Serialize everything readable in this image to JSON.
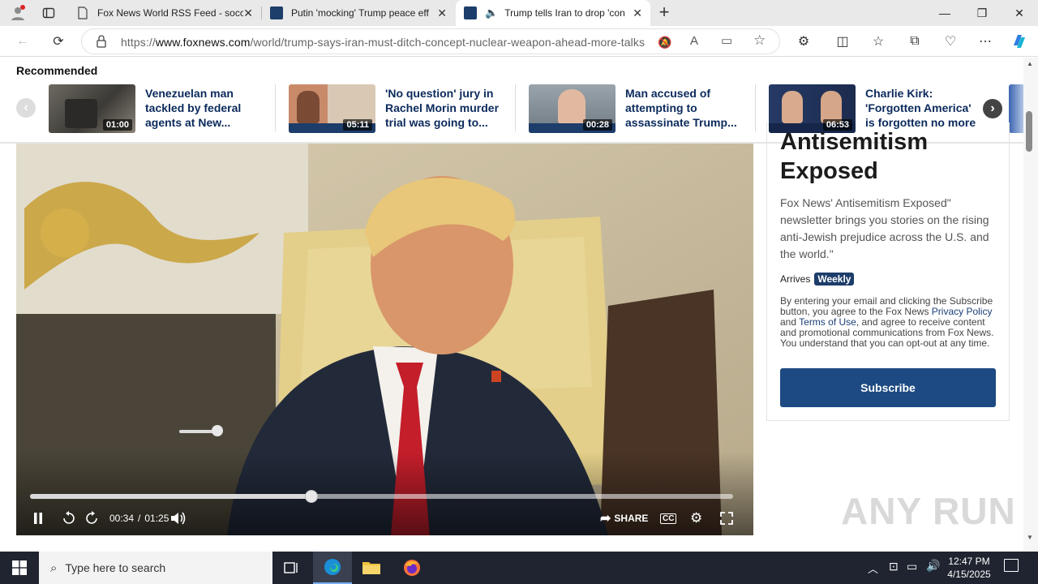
{
  "browser": {
    "tabs": [
      {
        "title": "Fox News World RSS Feed - socc"
      },
      {
        "title": "Putin 'mocking' Trump peace eff"
      },
      {
        "title": "Trump tells Iran to drop 'con"
      }
    ],
    "url_prefix": "https://",
    "url_domain": "www.foxnews.com",
    "url_path": "/world/trump-says-iran-must-ditch-concept-nuclear-weapon-ahead-more-talks"
  },
  "recommended": {
    "heading": "Recommended",
    "items": [
      {
        "title": "Venezuelan man tackled by federal agents at New...",
        "duration": "01:00"
      },
      {
        "title": "'No question' jury in Rachel Morin murder trial was going to...",
        "duration": "05:11"
      },
      {
        "title": "Man accused of attempting to assassinate Trump...",
        "duration": "00:28"
      },
      {
        "title": "Charlie Kirk: 'Forgotten America' is forgotten no more",
        "duration": "06:53"
      }
    ]
  },
  "video": {
    "current_time": "00:34",
    "separator": "/",
    "total_time": "01:25",
    "progress": 0.4,
    "volume": 0.9,
    "share_label": "SHARE",
    "cc_label": "CC"
  },
  "newsletter": {
    "heading": "Antisemitism Exposed",
    "description": "Fox News' Antisemitism Exposed\" newsletter brings you stories on the rising anti-Jewish prejudice across the U.S. and the world.\"",
    "arrives_label": "Arrives",
    "frequency": "Weekly",
    "legal_1": "By entering your email and clicking the Subscribe button, you agree to the Fox News ",
    "privacy_link": "Privacy Policy",
    "legal_2": " and ",
    "terms_link": "Terms of Use",
    "legal_3": ", and agree to receive content and promotional communications from Fox News. You understand that you can opt-out at any time.",
    "subscribe_label": "Subscribe"
  },
  "watermark": "ANY RUN",
  "taskbar": {
    "search_placeholder": "Type here to search",
    "time": "12:47 PM",
    "date": "4/15/2025"
  },
  "colors": {
    "fox_navy": "#1d4a82",
    "headline_blue": "#0b2a5c",
    "taskbar": "#1f2430"
  }
}
